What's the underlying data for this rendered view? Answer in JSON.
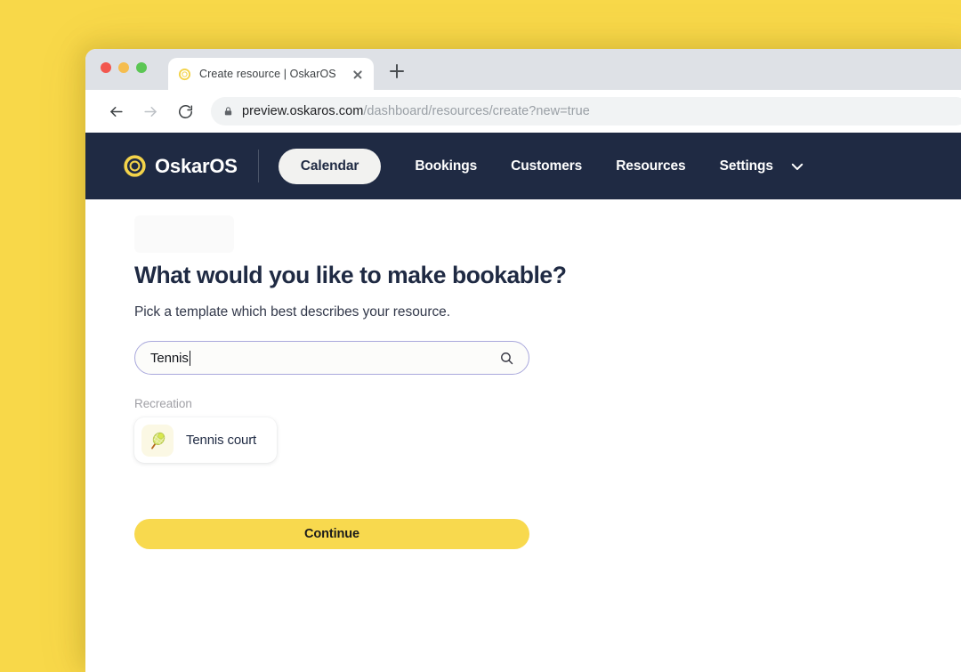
{
  "desktop": {
    "background_color": "#F8D849"
  },
  "browser": {
    "tab": {
      "title": "Create resource | OskarOS",
      "favicon": "oskaros-ring-icon",
      "close_icon": "close-icon"
    },
    "new_tab_icon": "plus-icon",
    "toolbar": {
      "back_icon": "arrow-left-icon",
      "forward_icon": "arrow-right-icon",
      "reload_icon": "reload-icon",
      "lock_icon": "lock-icon",
      "url_host": "preview.oskaros.com",
      "url_path": "/dashboard/resources/create?new=true"
    },
    "traffic_lights": {
      "close_color": "#F2574F",
      "minimize_color": "#F5BD4F",
      "zoom_color": "#5BC654"
    }
  },
  "appnav": {
    "background_color": "#1F2A43",
    "brand_name": "OskarOS",
    "brand_icon": "oskaros-ring-icon",
    "active_item": "Calendar",
    "items": [
      {
        "label": "Calendar",
        "active": true
      },
      {
        "label": "Bookings",
        "active": false
      },
      {
        "label": "Customers",
        "active": false
      },
      {
        "label": "Resources",
        "active": false
      },
      {
        "label": "Settings",
        "active": false
      }
    ],
    "caret_icon": "chevron-down-icon"
  },
  "main": {
    "heading": "What would you like to make bookable?",
    "subheading": "Pick a template which best describes your resource.",
    "search": {
      "value": "Tennis",
      "placeholder": "Search templates",
      "icon": "search-icon",
      "border_color": "#A9A8DC",
      "has_cursor": true
    },
    "results": [
      {
        "category": "Recreation",
        "templates": [
          {
            "label": "Tennis court",
            "emoji_icon": "tennis-racket-icon"
          }
        ]
      }
    ],
    "continue_label": "Continue",
    "continue_color": "#F8D94E"
  }
}
